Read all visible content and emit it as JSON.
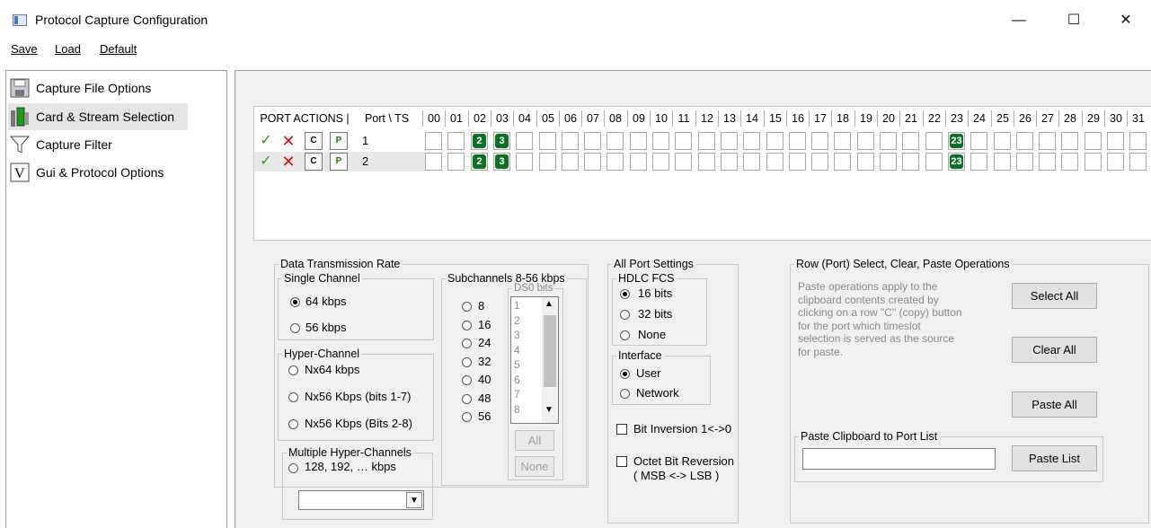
{
  "window": {
    "title": "Protocol Capture Configuration",
    "min": "—",
    "max": "☐",
    "close": "✕"
  },
  "menu": {
    "save": "Save",
    "load": "Load",
    "default": "Default"
  },
  "sidebar": {
    "items": [
      {
        "label": "Capture File Options"
      },
      {
        "label": "Card & Stream Selection"
      },
      {
        "label": "Capture Filter"
      },
      {
        "label": "Gui & Protocol Options"
      }
    ]
  },
  "grid": {
    "port_actions": "PORT ACTIONS |",
    "port_ts": "Port \\ TS",
    "timeslots": [
      "00",
      "01",
      "02",
      "03",
      "04",
      "05",
      "06",
      "07",
      "08",
      "09",
      "10",
      "11",
      "12",
      "13",
      "14",
      "15",
      "16",
      "17",
      "18",
      "19",
      "20",
      "21",
      "22",
      "23",
      "24",
      "25",
      "26",
      "27",
      "28",
      "29",
      "30",
      "31"
    ],
    "rows": [
      {
        "port": "1",
        "selected": [
          2,
          3,
          23
        ]
      },
      {
        "port": "2",
        "selected": [
          2,
          3,
          23
        ]
      }
    ],
    "slot_labels": {
      "2": "2",
      "3": "3",
      "23": "23"
    },
    "icons": {
      "check": "✓",
      "x": "✕",
      "copy": "C",
      "paste": "P"
    }
  },
  "rate": {
    "legend": "Data Transmission Rate",
    "single": {
      "legend": "Single Channel",
      "opt1": "64 kbps",
      "opt2": "56 kbps"
    },
    "hyper": {
      "legend": "Hyper-Channel",
      "opt1": "Nx64 kbps",
      "opt2": "Nx56 Kbps (bits 1-7)",
      "opt3": "Nx56 Kbps (Bits 2-8)"
    },
    "multi": {
      "legend": "Multiple Hyper-Channels",
      "opt1": "128, 192, … kbps",
      "select_value": ""
    },
    "sub": {
      "legend": "Subchannels 8-56 kbps",
      "opts": [
        "8",
        "16",
        "24",
        "32",
        "40",
        "48",
        "56"
      ],
      "ds0_legend": "DS0 bits",
      "ds0_items": [
        "1",
        "2",
        "3",
        "4",
        "5",
        "6",
        "7",
        "8"
      ],
      "all": "All",
      "none": "None"
    }
  },
  "port_settings": {
    "legend": "All Port Settings",
    "hdlc": {
      "legend": "HDLC FCS",
      "opt1": "16 bits",
      "opt2": "32 bits",
      "opt3": "None"
    },
    "iface": {
      "legend": "Interface",
      "opt1": "User",
      "opt2": "Network"
    },
    "bitinv": "Bit Inversion 1<->0",
    "octet1": "Octet Bit Reversion",
    "octet2": "( MSB <-> LSB )"
  },
  "ops": {
    "legend": "Row (Port) Select, Clear, Paste Operations",
    "note": [
      "Paste operations apply to the",
      "clipboard contents created by",
      "clicking on a row \"C\" (copy) button",
      "for the port which timeslot",
      "selection is served as the source",
      "for paste."
    ],
    "select_all": "Select All",
    "clear_all": "Clear All",
    "paste_all": "Paste All",
    "paste_list_legend": "Paste Clipboard to Port List",
    "paste_list_value": "",
    "paste_list_btn": "Paste List"
  }
}
